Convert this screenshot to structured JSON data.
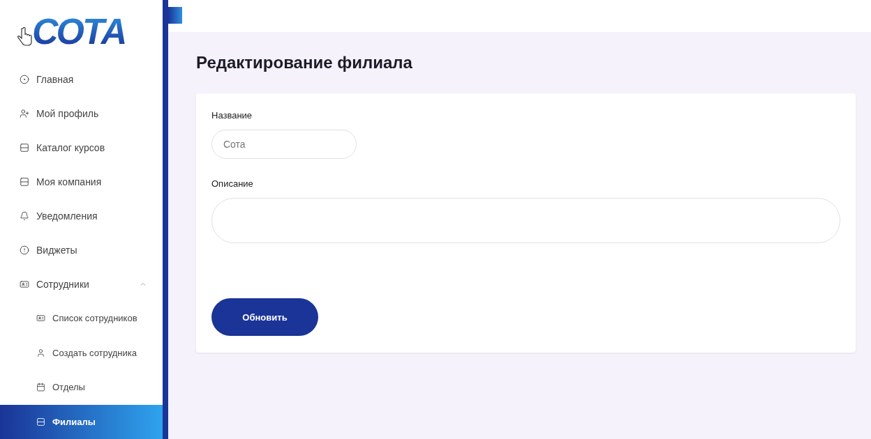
{
  "logo": "СОТА",
  "sidebar": {
    "items": [
      {
        "label": "Главная",
        "selected": false
      },
      {
        "label": "Мой профиль",
        "selected": false
      },
      {
        "label": "Каталог курсов",
        "selected": false
      },
      {
        "label": "Моя компания",
        "selected": false
      },
      {
        "label": "Уведомления",
        "selected": false
      },
      {
        "label": "Виджеты",
        "selected": false
      },
      {
        "label": "Сотрудники",
        "selected": false,
        "expanded": true,
        "children": [
          {
            "label": "Список сотрудников",
            "selected": false
          },
          {
            "label": "Создать сотрудника",
            "selected": false
          },
          {
            "label": "Отделы",
            "selected": false
          },
          {
            "label": "Филиалы",
            "selected": true
          }
        ]
      }
    ]
  },
  "page": {
    "title": "Редактирование филиала"
  },
  "form": {
    "fields": [
      {
        "label": "Название",
        "value": "Сота",
        "kind": "short"
      },
      {
        "label": "Описание",
        "kind": "long"
      }
    ],
    "submit": "Обновить"
  }
}
